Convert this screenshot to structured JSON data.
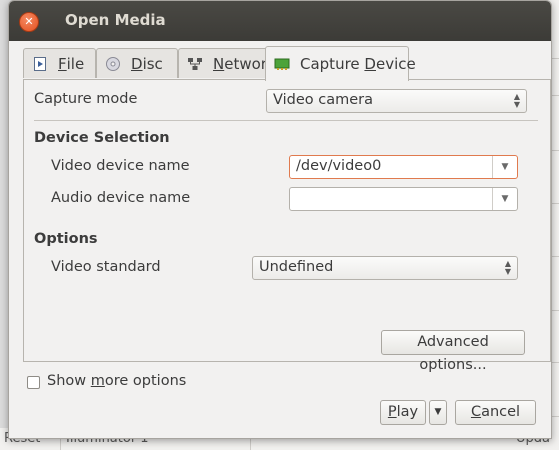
{
  "window": {
    "title": "Open Media"
  },
  "tabs": [
    {
      "label": "File",
      "mnemonic": "F",
      "rest": "ile",
      "icon": "file-icon"
    },
    {
      "label": "Disc",
      "mnemonic": "D",
      "rest": "isc",
      "icon": "disc-icon"
    },
    {
      "label": "Network",
      "mnemonic": "N",
      "rest": "etwork",
      "icon": "network-icon"
    },
    {
      "label": "Capture Device",
      "before": "Capture ",
      "mnemonic": "D",
      "rest": "evice",
      "icon": "capture-card-icon",
      "active": true
    }
  ],
  "capture": {
    "mode_label": "Capture mode",
    "mode_value": "Video camera"
  },
  "device_selection": {
    "heading": "Device Selection",
    "video_label": "Video device name",
    "video_value": "/dev/video0",
    "audio_label": "Audio device name",
    "audio_value": ""
  },
  "options": {
    "heading": "Options",
    "standard_label": "Video standard",
    "standard_value": "Undefined",
    "advanced_button": "Advanced options..."
  },
  "footer": {
    "show_more_before": "Show ",
    "show_more_mnemonic": "m",
    "show_more_rest": "ore options",
    "play_mnemonic": "P",
    "play_rest": "lay",
    "cancel_mnemonic": "C",
    "cancel_rest": "ancel"
  },
  "background": {
    "bottom_texts": [
      "Reset",
      "Illuminator 1",
      "Upda"
    ]
  },
  "colors": {
    "titlebar": "#3c3b37",
    "close": "#e4501f",
    "focus_border": "#e07a4e",
    "dialog_bg": "#f2f1f0"
  }
}
